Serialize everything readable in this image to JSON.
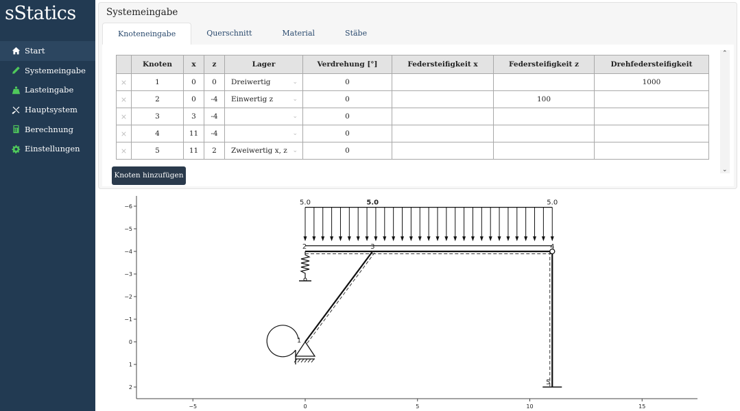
{
  "app": {
    "title": "sStatics"
  },
  "sidebar": {
    "items": [
      {
        "label": "Start",
        "icon": "home-icon"
      },
      {
        "label": "Systemeingabe",
        "icon": "pencil-icon"
      },
      {
        "label": "Lasteingabe",
        "icon": "weight-icon"
      },
      {
        "label": "Hauptsystem",
        "icon": "tools-icon"
      },
      {
        "label": "Berechnung",
        "icon": "calculator-icon"
      },
      {
        "label": "Einstellungen",
        "icon": "gear-icon"
      }
    ]
  },
  "panel": {
    "title": "Systemeingabe",
    "tabs": [
      "Knoteneingabe",
      "Querschnitt",
      "Material",
      "Stäbe"
    ],
    "add_button": "Knoten hinzufügen"
  },
  "table": {
    "delete_glyph": "×",
    "caret_glyph": "⌄",
    "headers": [
      "Knoten",
      "x",
      "z",
      "Lager",
      "Verdrehung [°]",
      "Federsteifigkeit x",
      "Federsteifigkeit z",
      "Drehfedersteifigkeit"
    ],
    "rows": [
      {
        "knoten": "1",
        "x": "0",
        "z": "0",
        "lager": "Dreiwertig",
        "verdrehung": "0",
        "fx": "",
        "fz": "",
        "drehfeder": "1000"
      },
      {
        "knoten": "2",
        "x": "0",
        "z": "-4",
        "lager": "Einwertig z",
        "verdrehung": "0",
        "fx": "",
        "fz": "100",
        "drehfeder": ""
      },
      {
        "knoten": "3",
        "x": "3",
        "z": "-4",
        "lager": "",
        "verdrehung": "0",
        "fx": "",
        "fz": "",
        "drehfeder": ""
      },
      {
        "knoten": "4",
        "x": "11",
        "z": "-4",
        "lager": "",
        "verdrehung": "0",
        "fx": "",
        "fz": "",
        "drehfeder": ""
      },
      {
        "knoten": "5",
        "x": "11",
        "z": "2",
        "lager": "Zweiwertig x, z",
        "verdrehung": "0",
        "fx": "",
        "fz": "",
        "drehfeder": ""
      }
    ]
  },
  "plot": {
    "x_ticks": [
      -5,
      0,
      5,
      10,
      15
    ],
    "x_tick_labels": [
      "−5",
      "0",
      "5",
      "10",
      "15"
    ],
    "z_ticks": [
      -6,
      -5,
      -4,
      -3,
      -2,
      -1,
      0,
      1,
      2
    ],
    "z_tick_labels": [
      "−6",
      "−5",
      "−4",
      "−3",
      "−2",
      "−1",
      "0",
      "1",
      "2"
    ],
    "load_labels": [
      "5.0",
      "5.0",
      "5.0"
    ],
    "load_value": 5.0,
    "load_from_x": 0,
    "load_to_x": 11,
    "node_labels": [
      "1",
      "2",
      "3",
      "4",
      "5"
    ],
    "nodes": [
      {
        "x": 0,
        "z": 0
      },
      {
        "x": 0,
        "z": -4
      },
      {
        "x": 3,
        "z": -4
      },
      {
        "x": 11,
        "z": -4
      },
      {
        "x": 11,
        "z": 2
      }
    ]
  },
  "colors": {
    "sidebar_bg": "#223a52",
    "button_bg": "#2a3a4c",
    "accent_green": "#4fc85b"
  }
}
